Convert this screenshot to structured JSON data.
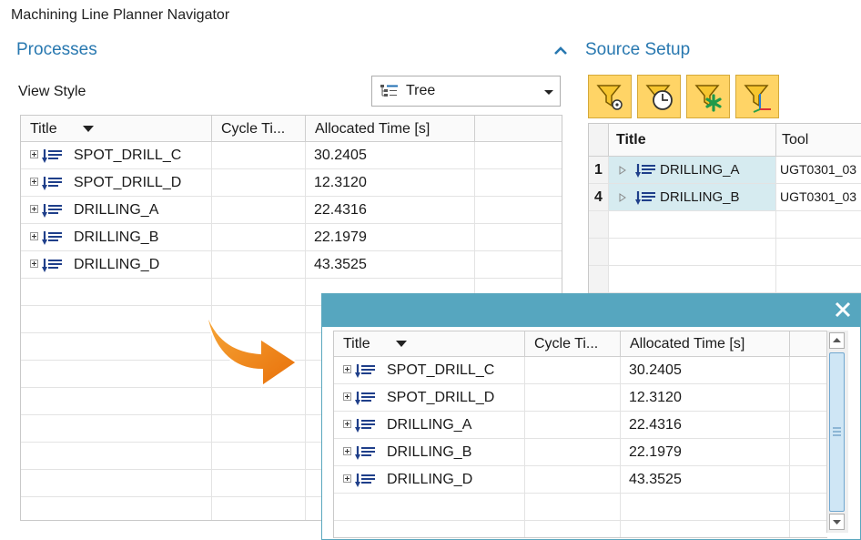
{
  "window": {
    "title": "Machining Line Planner Navigator"
  },
  "processes": {
    "title": "Processes",
    "view_style_label": "View Style",
    "view_style_value": "Tree",
    "columns": [
      "Title",
      "Cycle Ti...",
      "Allocated Time [s]"
    ],
    "rows": [
      {
        "title": "SPOT_DRILL_C",
        "cycle": "",
        "allocated": "30.2405"
      },
      {
        "title": "SPOT_DRILL_D",
        "cycle": "",
        "allocated": "12.3120"
      },
      {
        "title": "DRILLING_A",
        "cycle": "",
        "allocated": "22.4316"
      },
      {
        "title": "DRILLING_B",
        "cycle": "",
        "allocated": "22.1979"
      },
      {
        "title": "DRILLING_D",
        "cycle": "",
        "allocated": "43.3525"
      }
    ]
  },
  "source_setup": {
    "title": "Source Setup",
    "toolbar": [
      {
        "icon": "filter-settings-icon"
      },
      {
        "icon": "filter-clock-icon"
      },
      {
        "icon": "filter-asterisk-icon"
      },
      {
        "icon": "filter-axis-icon"
      }
    ],
    "columns": [
      "Title",
      "Tool"
    ],
    "rows": [
      {
        "num": "1",
        "title": "DRILLING_A",
        "tool": "UGT0301_03"
      },
      {
        "num": "4",
        "title": "DRILLING_B",
        "tool": "UGT0301_03"
      }
    ]
  },
  "dialog": {
    "columns": [
      "Title",
      "Cycle Ti...",
      "Allocated Time [s]"
    ],
    "rows": [
      {
        "title": "SPOT_DRILL_C",
        "cycle": "",
        "allocated": "30.2405"
      },
      {
        "title": "SPOT_DRILL_D",
        "cycle": "",
        "allocated": "12.3120"
      },
      {
        "title": "DRILLING_A",
        "cycle": "",
        "allocated": "22.4316"
      },
      {
        "title": "DRILLING_B",
        "cycle": "",
        "allocated": "22.1979"
      },
      {
        "title": "DRILLING_D",
        "cycle": "",
        "allocated": "43.3525"
      }
    ]
  },
  "colors": {
    "accent": "#2878b0",
    "dialog_bar": "#56a6bf",
    "toolbar_bg": "#ffd466",
    "arrow": "#f08a0c",
    "highlight": "#d6ebf0"
  }
}
